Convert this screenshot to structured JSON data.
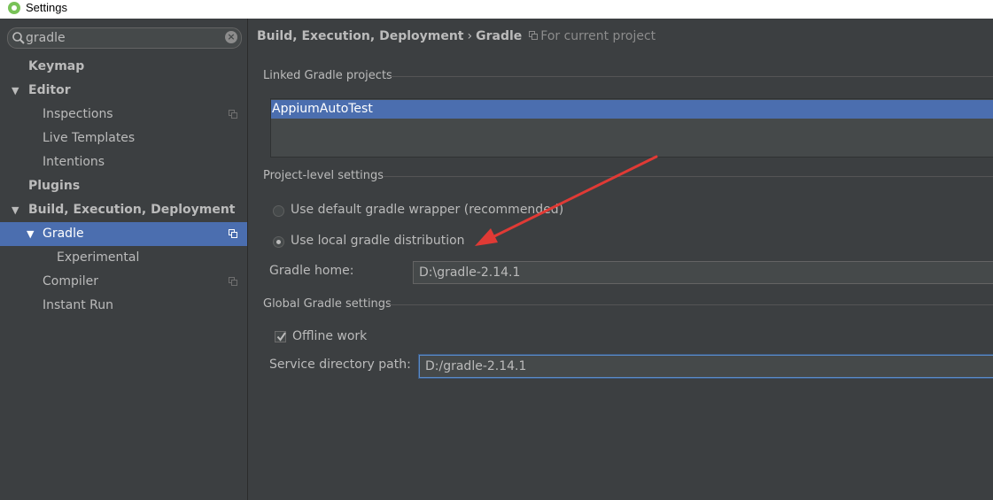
{
  "window": {
    "title": "Settings"
  },
  "search": {
    "value": "gradle"
  },
  "sidebar": {
    "items": [
      {
        "label": "Keymap"
      },
      {
        "label": "Editor"
      },
      {
        "label": "Inspections"
      },
      {
        "label": "Live Templates"
      },
      {
        "label": "Intentions"
      },
      {
        "label": "Plugins"
      },
      {
        "label": "Build, Execution, Deployment"
      },
      {
        "label": "Gradle"
      },
      {
        "label": "Experimental"
      },
      {
        "label": "Compiler"
      },
      {
        "label": "Instant Run"
      }
    ]
  },
  "breadcrumb": {
    "parent": "Build, Execution, Deployment",
    "separator": "›",
    "current": "Gradle",
    "scope": "For current project"
  },
  "linked_projects": {
    "title": "Linked Gradle projects",
    "items": [
      "AppiumAutoTest"
    ]
  },
  "project_settings": {
    "title": "Project-level settings",
    "option_wrapper": "Use default gradle wrapper (recommended)",
    "option_local": "Use local gradle distribution",
    "selected": "local",
    "gradle_home_label": "Gradle home:",
    "gradle_home_value": "D:\\gradle-2.14.1"
  },
  "global_settings": {
    "title": "Global Gradle settings",
    "offline_label": "Offline work",
    "offline_checked": true,
    "service_dir_label": "Service directory path:",
    "service_dir_value": "D:/gradle-2.14.1"
  },
  "colors": {
    "background": "#3c3f41",
    "selection": "#4b6eaf",
    "annotation_arrow": "#e03a35"
  }
}
